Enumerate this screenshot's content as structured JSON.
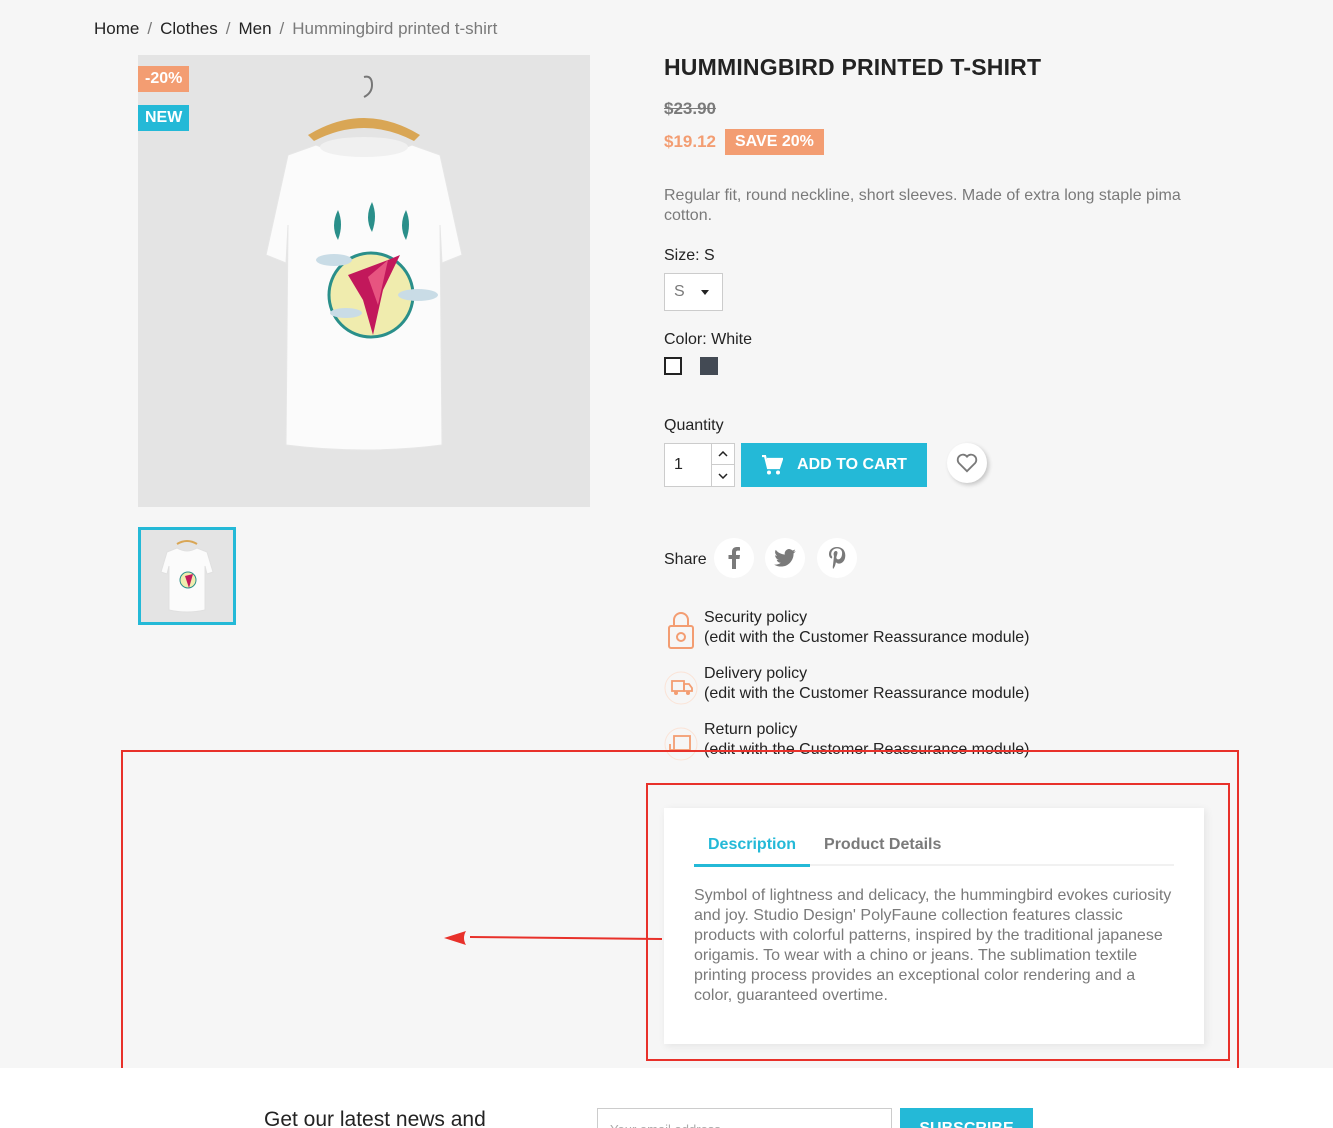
{
  "breadcrumb": {
    "home": "Home",
    "clothes": "Clothes",
    "men": "Men",
    "current": "Hummingbird printed t-shirt",
    "sep": "/"
  },
  "flags": {
    "discount": "-20%",
    "new": "NEW"
  },
  "product": {
    "title": "HUMMINGBIRD PRINTED T-SHIRT",
    "regular_price": "$23.90",
    "current_price": "$19.12",
    "save_badge": "SAVE 20%",
    "short_description": "Regular fit, round neckline, short sleeves. Made of extra long staple pima cotton."
  },
  "size": {
    "label": "Size: S",
    "selected": "S"
  },
  "color": {
    "label": "Color: White",
    "swatches": [
      "#ffffff",
      "#434a54"
    ]
  },
  "quantity": {
    "label": "Quantity",
    "value": "1"
  },
  "add_to_cart": "ADD TO CART",
  "share": {
    "label": "Share"
  },
  "reassurance": [
    {
      "title": "Security policy",
      "sub": "(edit with the Customer Reassurance module)"
    },
    {
      "title": "Delivery policy",
      "sub": "(edit with the Customer Reassurance module)"
    },
    {
      "title": "Return policy",
      "sub": "(edit with the Customer Reassurance module)"
    }
  ],
  "tabs": {
    "description": "Description",
    "details": "Product Details",
    "body": "Symbol of lightness and delicacy, the hummingbird evokes curiosity and joy. Studio Design' PolyFaune collection features classic products with colorful patterns, inspired by the traditional japanese origamis. To wear with a chino or jeans. The sublimation textile printing process provides an exceptional color rendering and a color, guaranteed overtime."
  },
  "newsletter": {
    "text": "Get our latest news and",
    "placeholder": "Your email address",
    "button": "SUBSCRIBE"
  },
  "colors": {
    "accent": "#24b9d7",
    "discount": "#f39d72",
    "annotation": "#e8312a"
  }
}
